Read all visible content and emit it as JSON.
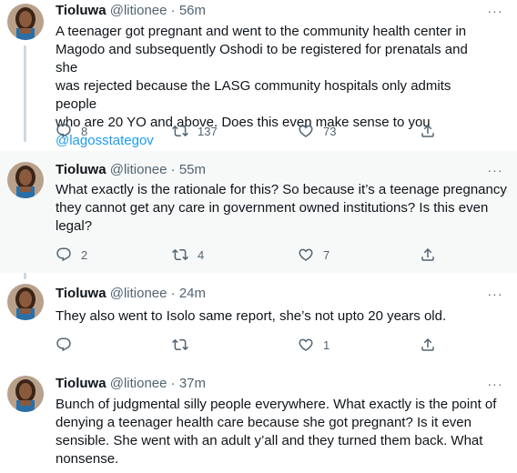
{
  "tweets": [
    {
      "name": "Tioluwa",
      "handle": "@litionee",
      "separator": "·",
      "time": "56m",
      "lines": [
        "A teenager got pregnant and went to the community health center in",
        "Magodo and subsequently Oshodi to be registered for prenatals and she",
        "was rejected because the LASG community hospitals only admits people",
        "who are 20 YO and above. Does this even make sense to you"
      ],
      "mention": "@lagosstategov",
      "replies": "8",
      "retweets": "137",
      "likes": "73"
    },
    {
      "name": "Tioluwa",
      "handle": "@litionee",
      "separator": "·",
      "time": "55m",
      "lines": [
        "What exactly is the rationale for this? So because it’s a teenage pregnancy",
        "they cannot get any care in government owned institutions? Is this even",
        "legal?"
      ],
      "replies": "2",
      "retweets": "4",
      "likes": "7"
    },
    {
      "name": "Tioluwa",
      "handle": "@litionee",
      "separator": "·",
      "time": "24m",
      "lines": [
        "They also went to Isolo same report, she’s not upto 20 years old."
      ],
      "replies": "",
      "retweets": "",
      "likes": "1"
    },
    {
      "name": "Tioluwa",
      "handle": "@litionee",
      "separator": "·",
      "time": "37m",
      "lines": [
        "Bunch of judgmental silly people everywhere. What exactly is the point of",
        "denying a teenager health care because she got pregnant? Is it even",
        "sensible. She went with an adult y’all and they turned them back. What",
        "nonsense."
      ]
    }
  ],
  "more_glyph": "···",
  "colors": {
    "text": "#0f1419",
    "muted": "#536471",
    "link": "#1d9bf0",
    "thread_line": "#cfd9de",
    "highlight_bg": "#f7f9f9"
  },
  "icons": [
    "reply-icon",
    "retweet-icon",
    "like-icon",
    "share-icon",
    "more-icon"
  ]
}
